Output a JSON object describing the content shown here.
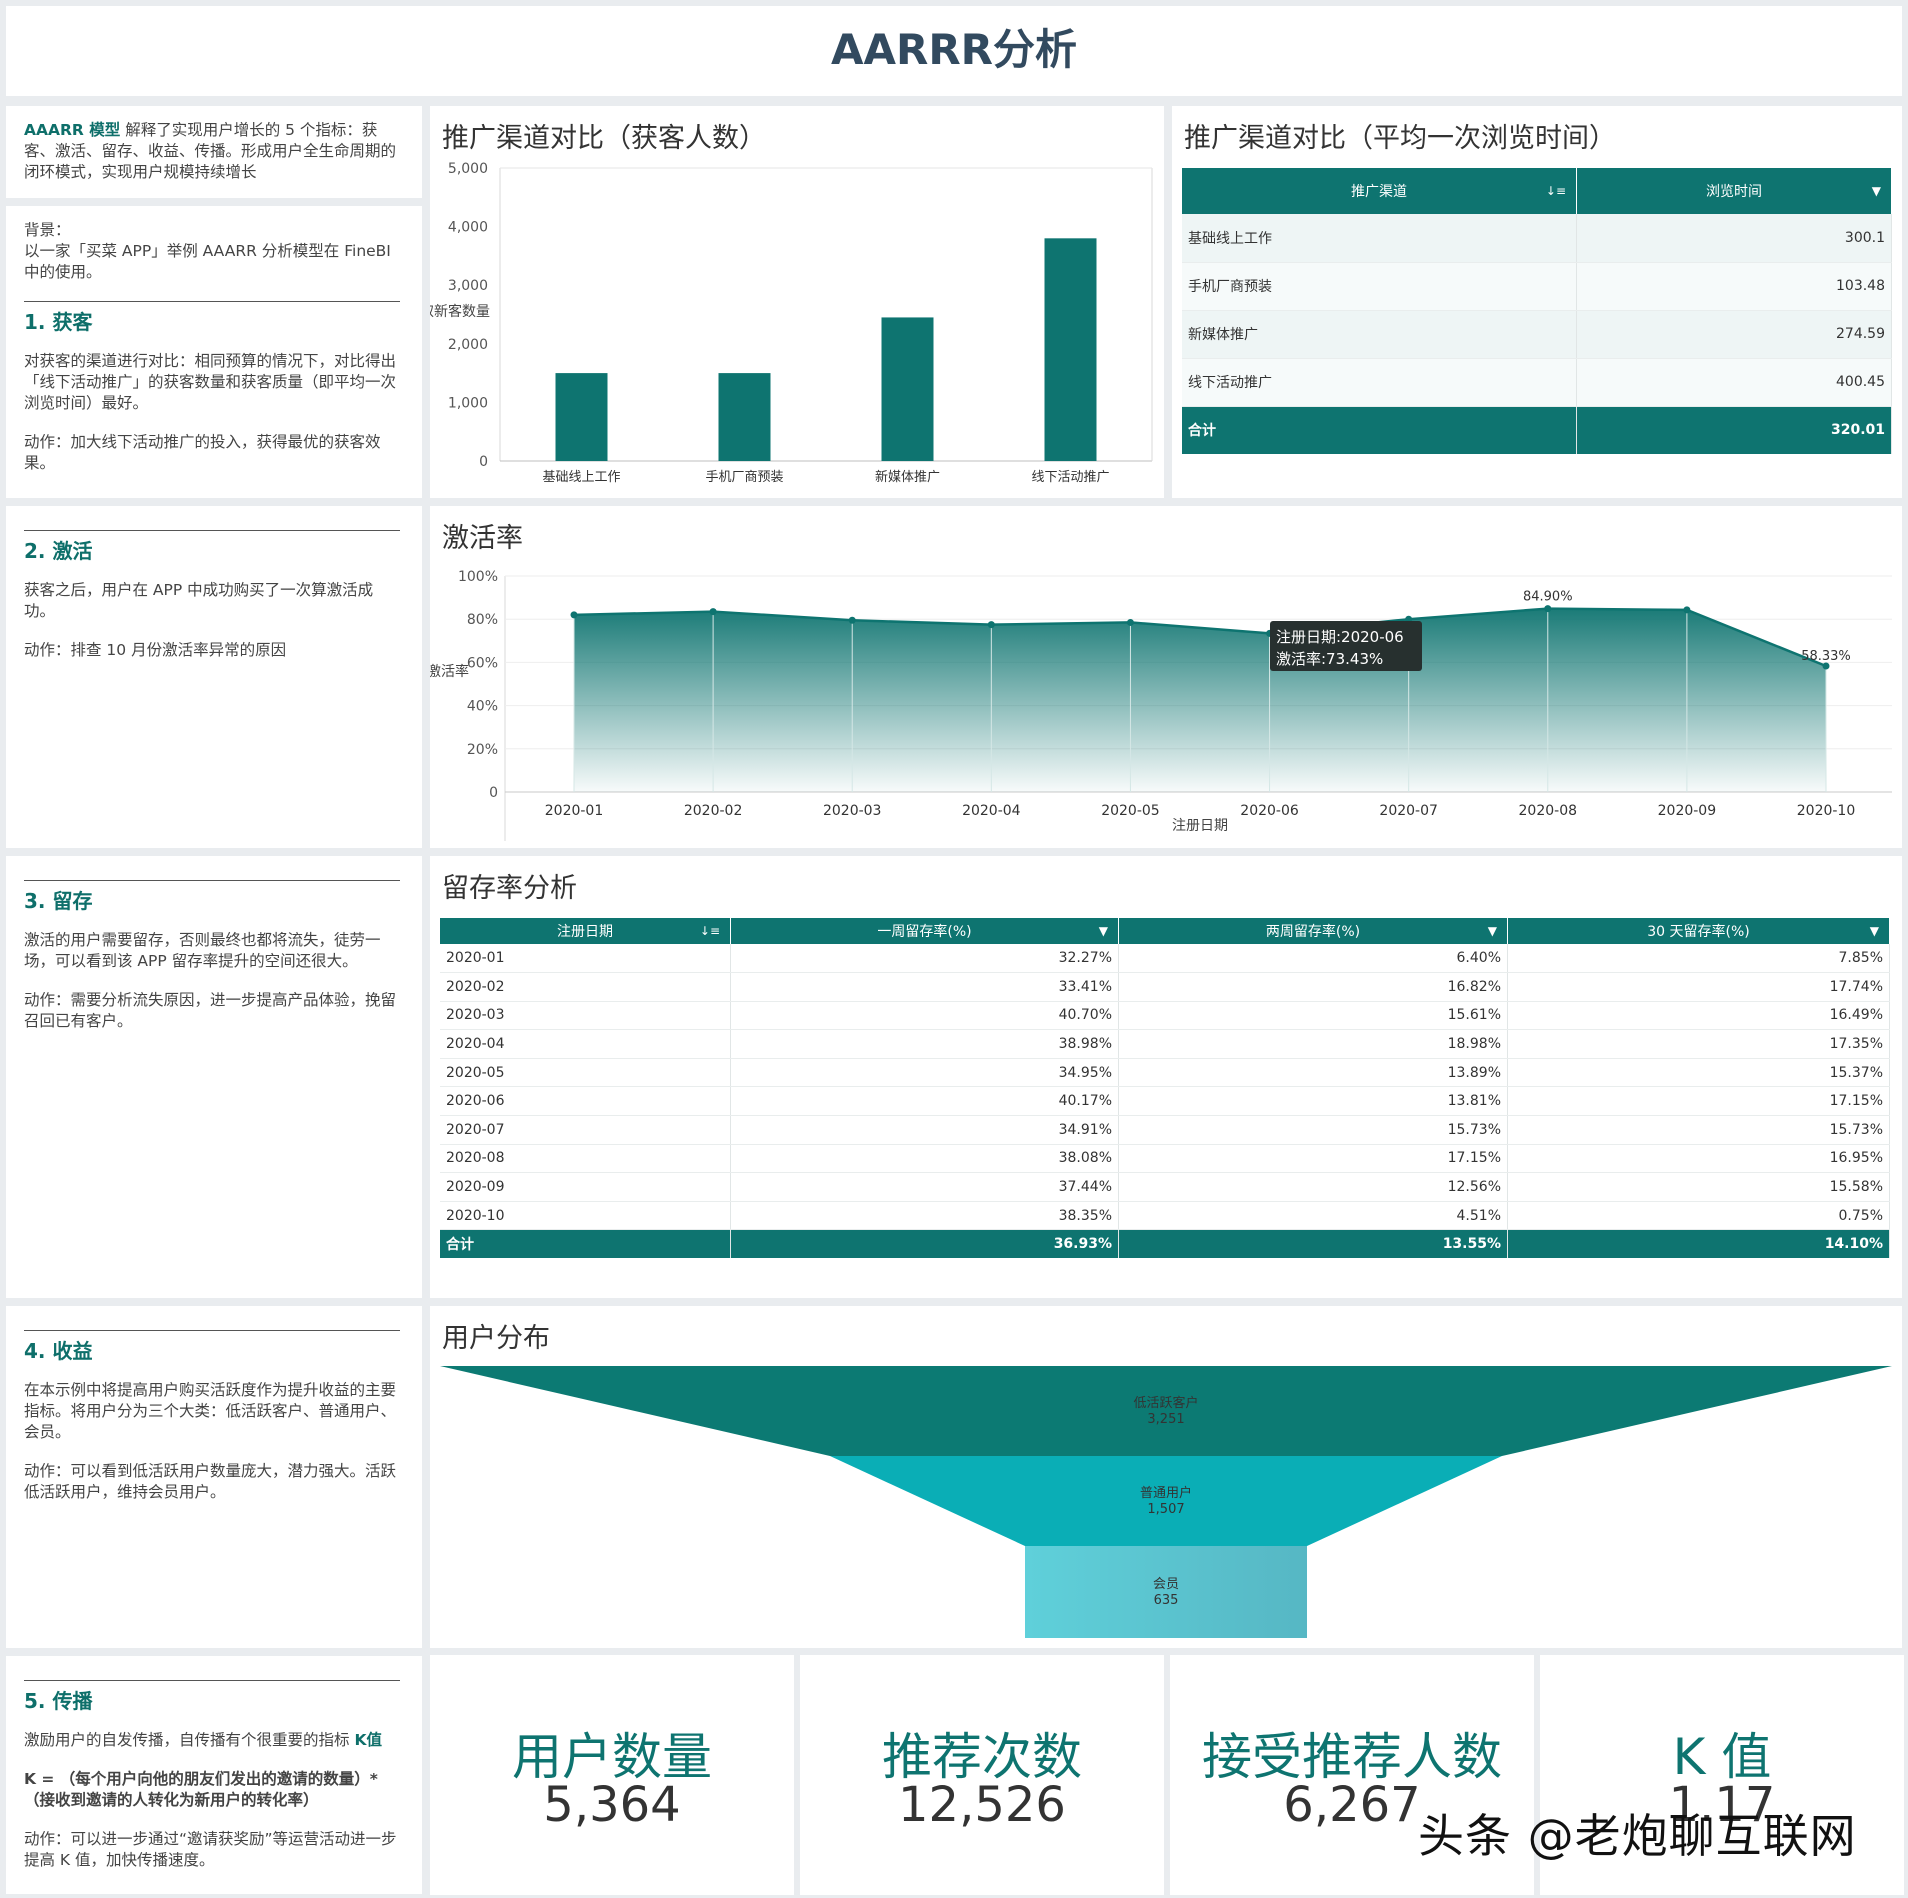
{
  "page_title": "AARRR分析",
  "intro": {
    "bold": "AAARR 模型",
    "text": " 解释了实现用户增长的 5 个指标：获客、激活、留存、收益、传播。形成用户全生命周期的闭环模式，实现用户规模持续增长"
  },
  "background": {
    "label": "背景：",
    "text": "以一家「买菜 APP」举例 AAARR 分析模型在 FineBI 中的使用。"
  },
  "sections": {
    "acquisition": {
      "heading": "1. 获客",
      "desc": "对获客的渠道进行对比：相同预算的情况下，对比得出「线下活动推广」的获客数量和获客质量（即平均一次浏览时间）最好。",
      "action": "动作：加大线下活动推广的投入，获得最优的获客效果。"
    },
    "activation": {
      "heading": "2. 激活",
      "desc": "获客之后，用户在 APP 中成功购买了一次算激活成功。",
      "action": "动作：排查 10 月份激活率异常的原因"
    },
    "retention": {
      "heading": "3. 留存",
      "desc": "激活的用户需要留存，否则最终也都将流失，徒劳一场，可以看到该 APP 留存率提升的空间还很大。",
      "action": "动作：需要分析流失原因，进一步提高产品体验，挽留召回已有客户。"
    },
    "revenue": {
      "heading": "4. 收益",
      "desc": "在本示例中将提高用户购买活跃度作为提升收益的主要指标。将用户分为三个大类：低活跃客户、普通用户、会员。",
      "action": "动作：可以看到低活跃用户数量庞大，潜力强大。活跃低活跃用户，维持会员用户。"
    },
    "referral": {
      "heading": "5. 传播",
      "desc_prefix": "激励用户的自发传播，自传播有个很重要的指标 ",
      "desc_bold": "K值",
      "formula_bold": "K = （每个用户向他的朋友们发出的邀请的数量）*（接收到邀请的人转化为新用户的转化率）",
      "action": "动作：可以进一步通过“邀请获奖励”等运营活动进一步提高 K 值，加快传播速度。"
    }
  },
  "acquisition_chart": {
    "title": "推广渠道对比（获客人数）",
    "ylabel": "获取新客数量",
    "yticks": [
      "0",
      "1,000",
      "2,000",
      "3,000",
      "4,000",
      "5,000"
    ]
  },
  "browse_table": {
    "title": "推广渠道对比（平均一次浏览时间）",
    "headers": [
      "推广渠道",
      "浏览时间"
    ],
    "rows": [
      [
        "基础线上工作",
        "300.1"
      ],
      [
        "手机厂商预装",
        "103.48"
      ],
      [
        "新媒体推广",
        "274.59"
      ],
      [
        "线下活动推广",
        "400.45"
      ]
    ],
    "total": [
      "合计",
      "320.01"
    ]
  },
  "activation_chart": {
    "title": "激活率",
    "ylabel": "激活率",
    "xlabel": "注册日期",
    "yticks": [
      "0",
      "20%",
      "40%",
      "60%",
      "80%",
      "100%"
    ],
    "tooltip_date_label": "注册日期:2020-06",
    "tooltip_value_label": "激活率:73.43%",
    "label_aug": "84.90%",
    "label_oct": "58.33%"
  },
  "retention_table": {
    "title": "留存率分析",
    "headers": [
      "注册日期",
      "一周留存率(%)",
      "两周留存率(%)",
      "30 天留存率(%)"
    ],
    "rows": [
      [
        "2020-01",
        "32.27%",
        "6.40%",
        "7.85%"
      ],
      [
        "2020-02",
        "33.41%",
        "16.82%",
        "17.74%"
      ],
      [
        "2020-03",
        "40.70%",
        "15.61%",
        "16.49%"
      ],
      [
        "2020-04",
        "38.98%",
        "18.98%",
        "17.35%"
      ],
      [
        "2020-05",
        "34.95%",
        "13.89%",
        "15.37%"
      ],
      [
        "2020-06",
        "40.17%",
        "13.81%",
        "17.15%"
      ],
      [
        "2020-07",
        "34.91%",
        "15.73%",
        "15.73%"
      ],
      [
        "2020-08",
        "38.08%",
        "17.15%",
        "16.95%"
      ],
      [
        "2020-09",
        "37.44%",
        "12.56%",
        "15.58%"
      ],
      [
        "2020-10",
        "38.35%",
        "4.51%",
        "0.75%"
      ]
    ],
    "total": [
      "合计",
      "36.93%",
      "13.55%",
      "14.10%"
    ]
  },
  "funnel": {
    "title": "用户分布",
    "stages": [
      {
        "label": "低活跃客户",
        "value": "3,251"
      },
      {
        "label": "普通用户",
        "value": "1,507"
      },
      {
        "label": "会员",
        "value": "635"
      }
    ]
  },
  "kpis": [
    {
      "label": "用户数量",
      "value": "5,364"
    },
    {
      "label": "推荐次数",
      "value": "12,526"
    },
    {
      "label": "接受推荐人数",
      "value": "6,267"
    },
    {
      "label": "K 值",
      "value": "1.17"
    }
  ],
  "watermark": "头条 @老炮聊互联网",
  "colors": {
    "primary": "#0e7470",
    "funnel": [
      "#0c7a73",
      "#0aaeb6",
      "#5cc6cf"
    ],
    "title": "#324a5f"
  },
  "chart_data": [
    {
      "type": "bar",
      "title": "推广渠道对比（获客人数）",
      "ylabel": "获取新客数量",
      "categories": [
        "基础线上工作",
        "手机厂商预装",
        "新媒体推广",
        "线下活动推广"
      ],
      "values": [
        1500,
        1500,
        2450,
        3800
      ],
      "ylim": [
        0,
        5000
      ],
      "grid": false
    },
    {
      "type": "area",
      "title": "激活率",
      "xlabel": "注册日期",
      "ylabel": "激活率",
      "x": [
        "2020-01",
        "2020-02",
        "2020-03",
        "2020-04",
        "2020-05",
        "2020-06",
        "2020-07",
        "2020-08",
        "2020-09",
        "2020-10"
      ],
      "values": [
        82.0,
        83.5,
        79.5,
        77.5,
        78.5,
        73.43,
        80.0,
        84.9,
        84.3,
        58.33
      ],
      "ylim": [
        0,
        100
      ],
      "grid": true
    },
    {
      "type": "table",
      "title": "推广渠道对比（平均一次浏览时间）",
      "columns": [
        "推广渠道",
        "浏览时间"
      ],
      "rows": [
        [
          "基础线上工作",
          300.1
        ],
        [
          "手机厂商预装",
          103.48
        ],
        [
          "新媒体推广",
          274.59
        ],
        [
          "线下活动推广",
          400.45
        ]
      ],
      "total": 320.01
    },
    {
      "type": "table",
      "title": "留存率分析",
      "columns": [
        "注册日期",
        "一周留存率(%)",
        "两周留存率(%)",
        "30 天留存率(%)"
      ],
      "rows": [
        [
          "2020-01",
          32.27,
          6.4,
          7.85
        ],
        [
          "2020-02",
          33.41,
          16.82,
          17.74
        ],
        [
          "2020-03",
          40.7,
          15.61,
          16.49
        ],
        [
          "2020-04",
          38.98,
          18.98,
          17.35
        ],
        [
          "2020-05",
          34.95,
          13.89,
          15.37
        ],
        [
          "2020-06",
          40.17,
          13.81,
          17.15
        ],
        [
          "2020-07",
          34.91,
          15.73,
          15.73
        ],
        [
          "2020-08",
          38.08,
          17.15,
          16.95
        ],
        [
          "2020-09",
          37.44,
          12.56,
          15.58
        ],
        [
          "2020-10",
          38.35,
          4.51,
          0.75
        ]
      ],
      "total": [
        36.93,
        13.55,
        14.1
      ]
    },
    {
      "type": "funnel",
      "title": "用户分布",
      "categories": [
        "低活跃客户",
        "普通用户",
        "会员"
      ],
      "values": [
        3251,
        1507,
        635
      ]
    }
  ]
}
